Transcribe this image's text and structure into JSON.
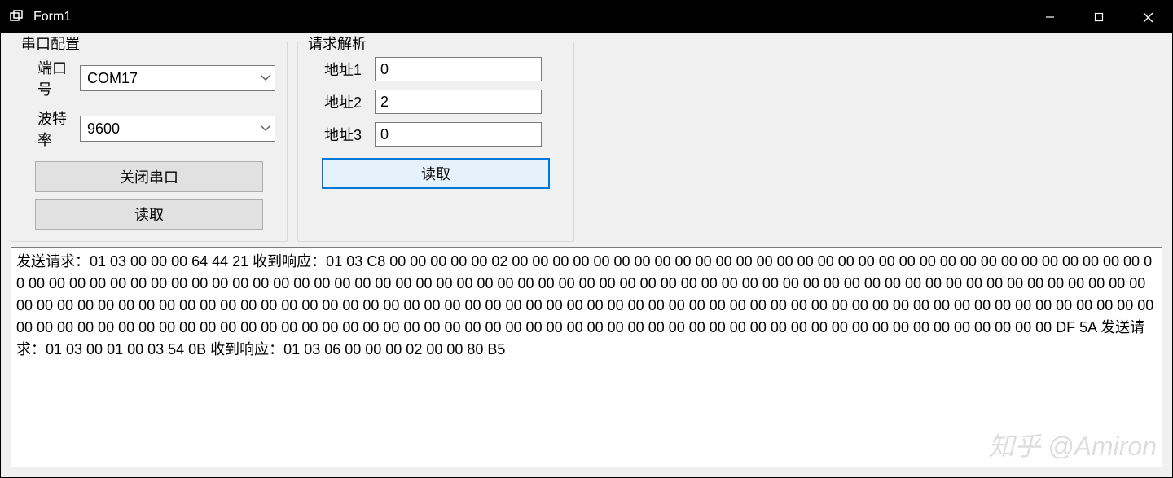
{
  "window": {
    "title": "Form1"
  },
  "serial_config": {
    "group_title": "串口配置",
    "port_label": "端口号",
    "port_value": "COM17",
    "baud_label": "波特率",
    "baud_value": "9600",
    "close_button": "关闭串口",
    "read_button": "读取"
  },
  "request_parse": {
    "group_title": "请求解析",
    "addr1_label": "地址1",
    "addr1_value": "0",
    "addr2_label": "地址2",
    "addr2_value": "2",
    "addr3_label": "地址3",
    "addr3_value": "0",
    "read_button": "读取"
  },
  "log": {
    "text": "发送请求：01 03 00 00 00 64 44 21\n收到响应：01 03 C8 00 00 00 00 00 02 00 00 00 00 00 00 00 00 00 00 00 00 00 00 00 00 00 00 00 00 00 00 00 00 00 00 00 00 00 00 00 00 00 00 00 00 00 00 00 00 00 00 00 00 00 00 00 00 00 00 00 00 00 00 00 00 00 00 00 00 00 00 00 00 00 00 00 00 00 00 00 00 00 00 00 00 00 00 00 00 00 00 00 00 00 00 00 00 00 00 00 00 00 00 00 00 00 00 00 00 00 00 00 00 00 00 00 00 00 00 00 00 00 00 00 00 00 00 00 00 00 00 00 00 00 00 00 00 00 00 00 00 00 00 00 00 00 00 00 00 00 00 00 00 00 00 00 00 00 00 00 00 00 00 00 00 00 00 00 00 00 00 00 00 00 00 00 00 00 00 00 00 00 00 00 00 00 00 00 00 00 00 00 00 00 00 00 00 00 00 00 00 00 00 DF 5A\n发送请求：01 03 00 01 00 03 54 0B\n收到响应：01 03 06 00 00 00 02 00 00 80 B5"
  },
  "watermark": "知乎 @Amiron"
}
